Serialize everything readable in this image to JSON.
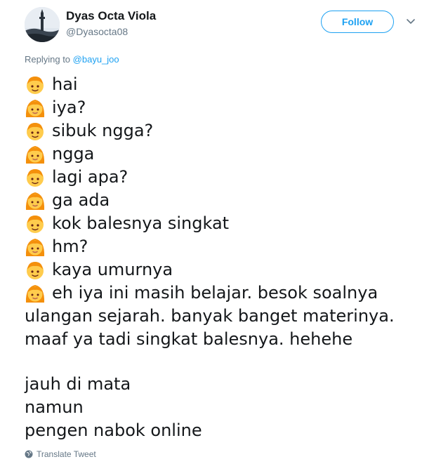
{
  "author": {
    "name": "Dyas Octa Viola",
    "handle": "@Dyasocta08",
    "avatar_icon": "tower-landscape-avatar"
  },
  "follow_label": "Follow",
  "caret_icon": "chevron-down-icon",
  "replying": {
    "prefix": "Replying to",
    "mention": "@bayu_joo"
  },
  "conversation": [
    {
      "speaker": "boy",
      "icon": "boy-emoji",
      "text": "hai"
    },
    {
      "speaker": "girl",
      "icon": "girl-emoji",
      "text": "iya?"
    },
    {
      "speaker": "boy",
      "icon": "boy-emoji",
      "text": "sibuk ngga?"
    },
    {
      "speaker": "girl",
      "icon": "girl-emoji",
      "text": "ngga"
    },
    {
      "speaker": "boy",
      "icon": "boy-emoji",
      "text": "lagi apa?"
    },
    {
      "speaker": "girl",
      "icon": "girl-emoji",
      "text": "ga ada"
    },
    {
      "speaker": "boy",
      "icon": "boy-emoji",
      "text": "kok balesnya singkat"
    },
    {
      "speaker": "girl",
      "icon": "girl-emoji",
      "text": "hm?"
    },
    {
      "speaker": "boy",
      "icon": "boy-emoji",
      "text": "kaya umurnya"
    },
    {
      "speaker": "girl",
      "icon": "girl-emoji",
      "text": "eh iya ini masih belajar. besok soalnya"
    }
  ],
  "continuation_lines": [
    "ulangan sejarah. banyak banget materinya.",
    "maaf ya tadi singkat balesnya. hehehe"
  ],
  "closing_lines": [
    "jauh di mata",
    "namun",
    "pengen nabok online"
  ],
  "translate_label": "Translate Tweet",
  "colors": {
    "accent": "#1da1f2",
    "secondary_text": "#657786",
    "primary_text": "#14171a"
  }
}
